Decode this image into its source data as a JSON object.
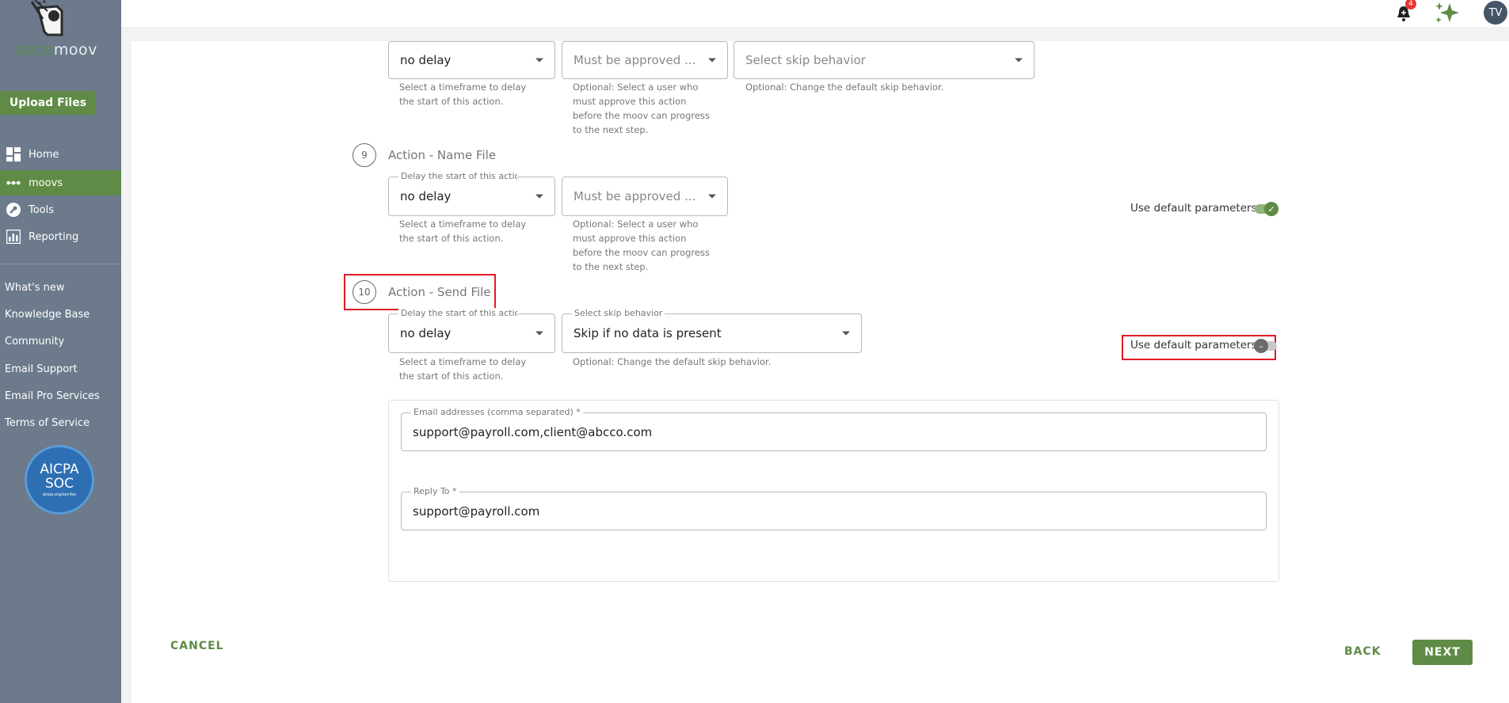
{
  "brand": {
    "logo_part1": "deco",
    "logo_part2": "moov",
    "accent": "#5f8b46"
  },
  "sidebar": {
    "upload_label": "Upload Files",
    "nav": [
      {
        "label": "Home",
        "icon": "dashboard-icon"
      },
      {
        "label": "moovs",
        "icon": "dots-icon",
        "active": true
      },
      {
        "label": "Tools",
        "icon": "wrench-icon"
      },
      {
        "label": "Reporting",
        "icon": "chart-icon"
      }
    ],
    "links": [
      "What's new",
      "Knowledge Base",
      "Community",
      "Email Support",
      "Email Pro Services",
      "Terms of Service"
    ],
    "badge": {
      "line1": "AICPA",
      "line2": "SOC",
      "line3": "aicpa.org/soc4so"
    }
  },
  "topbar": {
    "notification_count": "4",
    "avatar_initials": "TV"
  },
  "step8": {
    "delay_value": "no delay",
    "delay_helper": "Select a timeframe to delay the start of this action.",
    "approve_placeholder": "Must be approved ...",
    "approve_helper": "Optional: Select a user who must approve this action before the moov can progress to the next step.",
    "skip_placeholder": "Select skip behavior",
    "skip_helper": "Optional: Change the default skip behavior."
  },
  "step9": {
    "number": "9",
    "title": "Action - Name File",
    "delay_label": "Delay the start of this action",
    "delay_value": "no delay",
    "delay_helper": "Select a timeframe to delay the start of this action.",
    "approve_placeholder": "Must be approved ...",
    "approve_helper": "Optional: Select a user who must approve this action before the moov can progress to the next step.",
    "use_default_label": "Use default parameters",
    "use_default_on": true
  },
  "step10": {
    "number": "10",
    "title": "Action - Send File",
    "delay_label": "Delay the start of this action",
    "delay_value": "no delay",
    "delay_helper": "Select a timeframe to delay the start of this action.",
    "skip_label": "Select skip behavior",
    "skip_value": "Skip if no data is present",
    "skip_helper": "Optional: Change the default skip behavior.",
    "use_default_label": "Use default parameters",
    "use_default_on": false,
    "email_label": "Email addresses (comma separated) *",
    "email_value": "support@payroll.com,client@abcco.com",
    "reply_label": "Reply To *",
    "reply_value": "support@payroll.com"
  },
  "footer": {
    "cancel": "CANCEL",
    "back": "BACK",
    "next": "NEXT"
  }
}
